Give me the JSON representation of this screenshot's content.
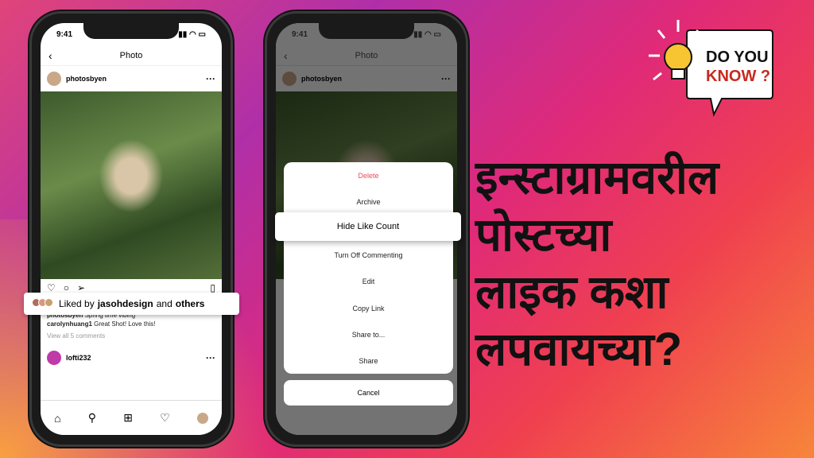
{
  "left_phone": {
    "time": "9:41",
    "nav_title": "Photo",
    "username": "photosbyen",
    "liked_prefix": "Liked by",
    "liked_user": "jasohdesign",
    "liked_and": "and",
    "liked_others": "others",
    "caption_user": "photosbyen",
    "caption_text": "Spring time vibing",
    "comment_user": "carolynhuang1",
    "comment_text": "Great Shot! Love this!",
    "view_comments": "View all 5 comments",
    "next_user": "lofti232"
  },
  "right_phone": {
    "time": "9:41",
    "nav_title": "Photo",
    "username": "photosbyen",
    "menu": [
      "Delete",
      "Archive",
      "Hide Like Count",
      "Turn Off Commenting",
      "Edit",
      "Copy Link",
      "Share to...",
      "Share"
    ],
    "cancel": "Cancel",
    "delete_color": "#ed4956"
  },
  "badge": {
    "line1": "DO YOU",
    "line2": "KNOW ?"
  },
  "headline": [
    "इन्स्टाग्रामवरील",
    "पोस्टच्या",
    "लाइक कशा",
    "लपवायच्या?"
  ]
}
